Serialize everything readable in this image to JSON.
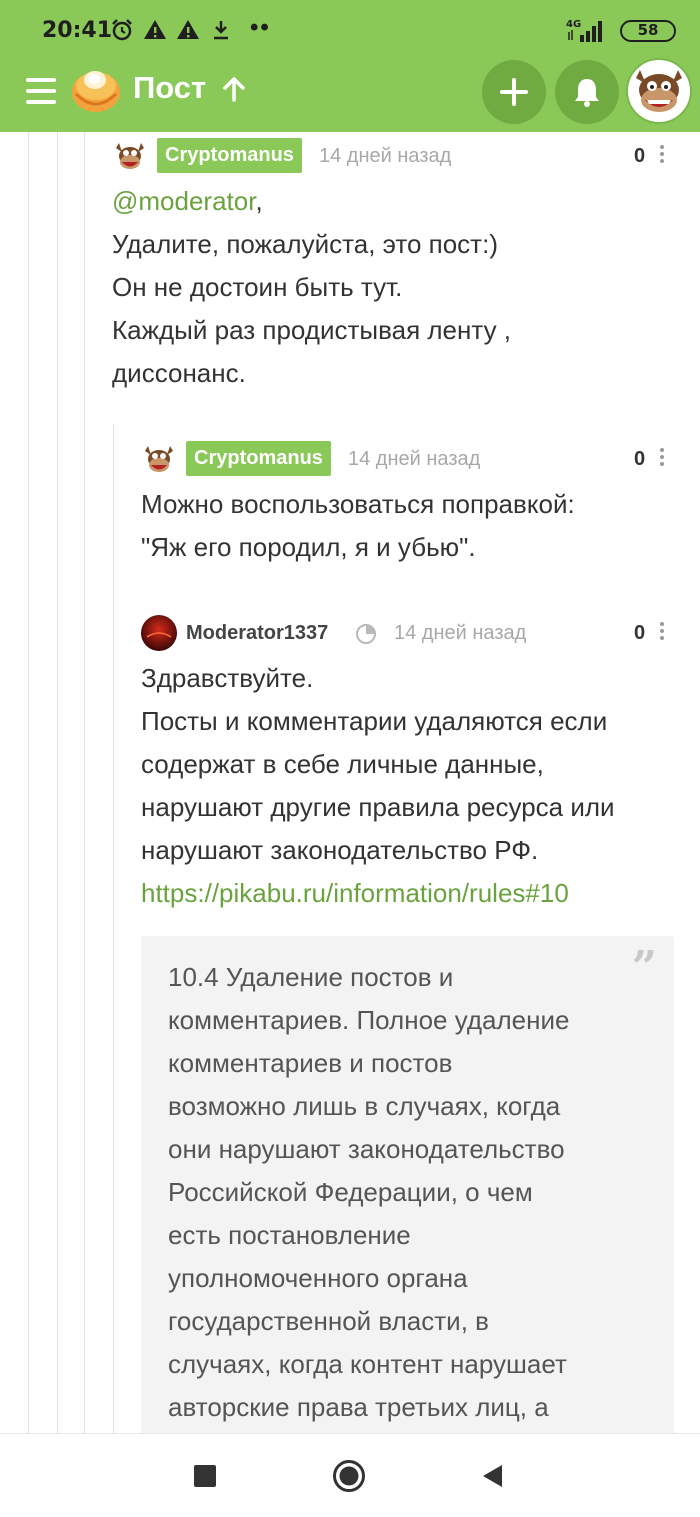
{
  "status_bar": {
    "time": "20:41",
    "network": "4G",
    "battery": "58",
    "more": "••"
  },
  "app_bar": {
    "title": "Пост",
    "accent_color": "#8ac858",
    "button_color": "#6fab40"
  },
  "comments": [
    {
      "author": "Cryptomanus",
      "time": "14 дней назад",
      "rating": "0",
      "mention": "@moderator",
      "mention_suffix": ",",
      "lines": [
        "Удалите, пожалуйста, это пост:)",
        "Он не достоин быть тут.",
        "Каждый раз продистывая ленту ,",
        "диссонанс."
      ]
    },
    {
      "author": "Cryptomanus",
      "time": "14 дней назад",
      "rating": "0",
      "lines": [
        "Можно воспользоваться поправкой:",
        "\"Яж его породил, я и убью\"."
      ]
    },
    {
      "author": "Moderator1337",
      "time": "14 дней назад",
      "rating": "0",
      "lines": [
        "Здравствуйте.",
        "Посты и комментарии удаляются если",
        "содержат в себе личные данные,",
        "нарушают другие правила ресурса или",
        "нарушают законодательство РФ."
      ],
      "link": "https://pikabu.ru/information/rules#10",
      "quote_lines": [
        "10.4 Удаление постов и",
        "комментариев. Полное удаление",
        "комментариев и постов",
        "возможно лишь в случаях, когда",
        "они нарушают законодательство",
        "Российской Федерации, о чем",
        "есть постановление",
        "уполномоченного органа",
        "государственной власти, в",
        "случаях, когда контент нарушает",
        "авторские права третьих лиц, а"
      ]
    }
  ]
}
